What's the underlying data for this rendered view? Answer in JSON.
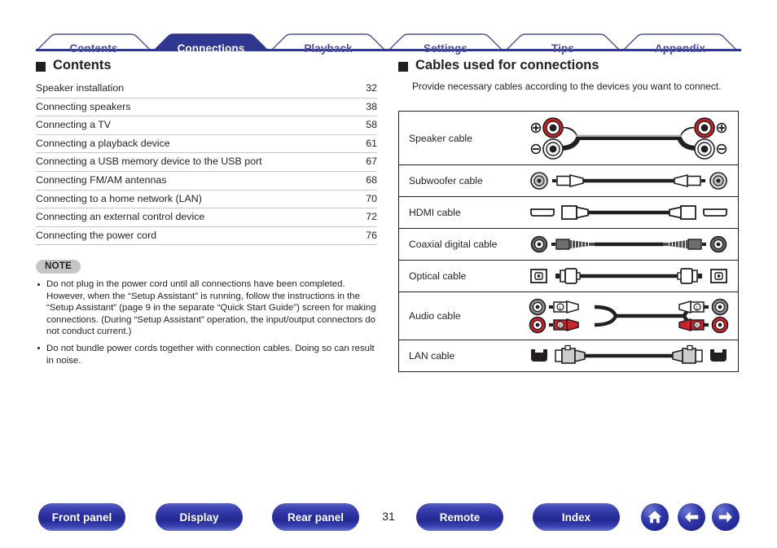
{
  "tabs": [
    {
      "label": "Contents",
      "active": false
    },
    {
      "label": "Connections",
      "active": true
    },
    {
      "label": "Playback",
      "active": false
    },
    {
      "label": "Settings",
      "active": false
    },
    {
      "label": "Tips",
      "active": false
    },
    {
      "label": "Appendix",
      "active": false
    }
  ],
  "left": {
    "heading": "Contents",
    "toc": [
      {
        "title": "Speaker installation",
        "page": "32"
      },
      {
        "title": "Connecting speakers",
        "page": "38"
      },
      {
        "title": "Connecting a TV",
        "page": "58"
      },
      {
        "title": "Connecting a playback device",
        "page": "61"
      },
      {
        "title": "Connecting a USB memory device to the USB port",
        "page": "67"
      },
      {
        "title": "Connecting FM/AM antennas",
        "page": "68"
      },
      {
        "title": "Connecting to a home network (LAN)",
        "page": "70"
      },
      {
        "title": "Connecting an external control device",
        "page": "72"
      },
      {
        "title": "Connecting the power cord",
        "page": "76"
      }
    ],
    "note": {
      "badge": "NOTE",
      "items": [
        "Do not plug in the power cord until all connections have been completed. However, when the “Setup Assistant” is running, follow the instructions in the “Setup Assistant” (page 9 in the separate “Quick Start Guide”) screen for making connections. (During “Setup Assistant” operation, the input/output connectors do not conduct current.)",
        "Do not bundle power cords together with connection cables. Doing so can result in noise."
      ]
    }
  },
  "right": {
    "heading": "Cables used for connections",
    "intro": "Provide necessary cables according to the devices you want to connect.",
    "rows": [
      {
        "name": "Speaker cable",
        "art": "speaker"
      },
      {
        "name": "Subwoofer cable",
        "art": "subwoofer"
      },
      {
        "name": "HDMI cable",
        "art": "hdmi"
      },
      {
        "name": "Coaxial digital cable",
        "art": "coaxial"
      },
      {
        "name": "Optical cable",
        "art": "optical"
      },
      {
        "name": "Audio cable",
        "art": "audio"
      },
      {
        "name": "LAN cable",
        "art": "lan"
      }
    ]
  },
  "footer": {
    "buttons": [
      {
        "label": "Front panel"
      },
      {
        "label": "Display"
      },
      {
        "label": "Rear panel"
      },
      {
        "label": "Remote"
      },
      {
        "label": "Index"
      }
    ],
    "page_number": "31",
    "icons": [
      {
        "name": "home-icon"
      },
      {
        "name": "back-arrow-icon"
      },
      {
        "name": "forward-arrow-icon"
      }
    ]
  },
  "colors": {
    "tab_active_fill": "#2f3790",
    "tab_inactive_text": "#4950a0",
    "rule": "#2f3790",
    "red_connector": "#d0202a",
    "note_badge_bg": "#c6c6c6"
  }
}
